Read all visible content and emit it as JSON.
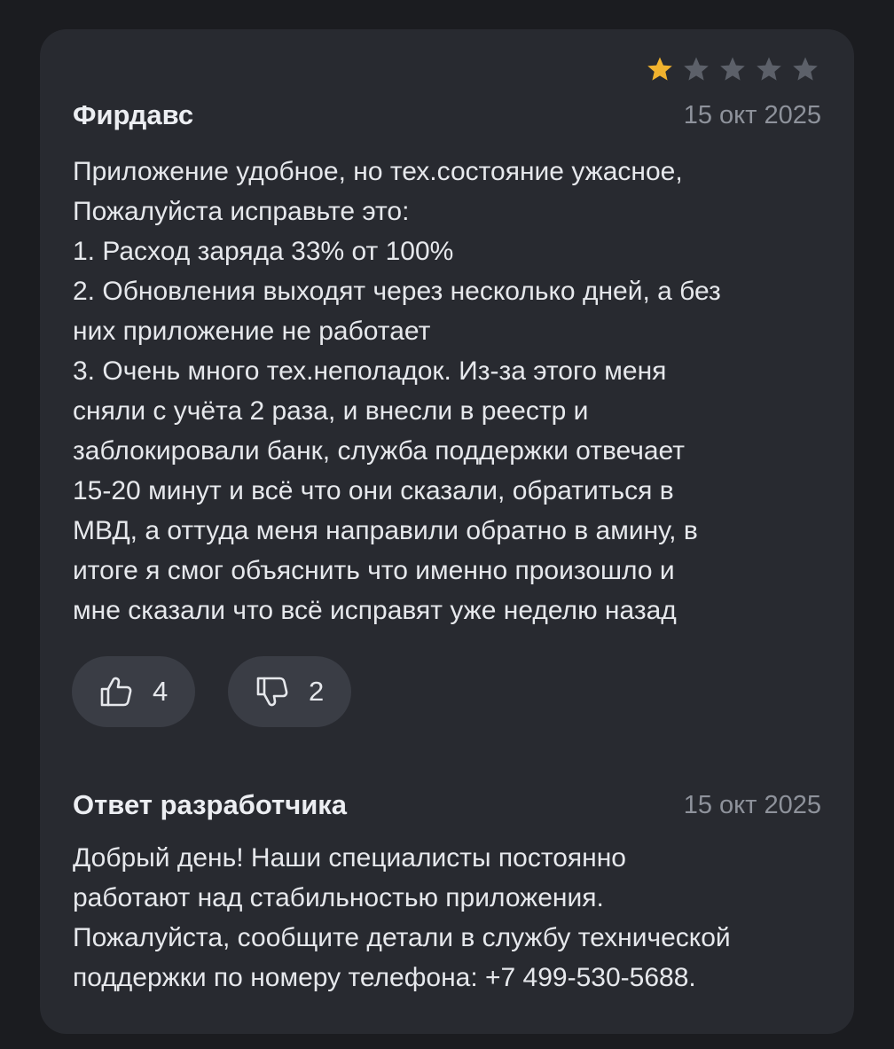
{
  "review": {
    "rating": 1,
    "max_rating": 5,
    "author": "Фирдавс",
    "date": "15 окт 2025",
    "text_lines": [
      "Приложение удобное, но тех.состояние ужасное,",
      "Пожалуйста исправьте это:",
      "1. Расход заряда 33% от 100%",
      "2. Обновления выходят через несколько дней, а без",
      "них приложение не работает",
      "3. Очень много тех.неполадок. Из-за этого меня",
      "сняли с учёта 2 раза, и внесли в реестр и",
      "заблокировали банк, служба поддержки отвечает",
      "15-20 минут и всё что они сказали, обратиться в",
      "МВД, а оттуда меня направили обратно в амину, в",
      "итоге я смог объяснить что именно произошло и",
      "мне сказали что всё исправят уже неделю назад"
    ],
    "likes": "4",
    "dislikes": "2"
  },
  "developer_reply": {
    "title": "Ответ разработчика",
    "date": "15 окт 2025",
    "text_lines": [
      "Добрый день! Наши специалисты постоянно",
      "работают над стабильностью приложения.",
      "Пожалуйста, сообщите детали в службу технической",
      "поддержки по номеру телефона: +7 499-530-5688."
    ]
  },
  "colors": {
    "background": "#1b1c20",
    "card": "#282a30",
    "star_filled": "#f0b22e",
    "star_empty": "#5c6069",
    "vote_pill": "#3a3d45",
    "text_primary": "#e6e8ec",
    "text_secondary": "#8e929b"
  },
  "icons": {
    "star": "star-icon",
    "like": "thumbs-up-icon",
    "dislike": "thumbs-down-icon"
  }
}
